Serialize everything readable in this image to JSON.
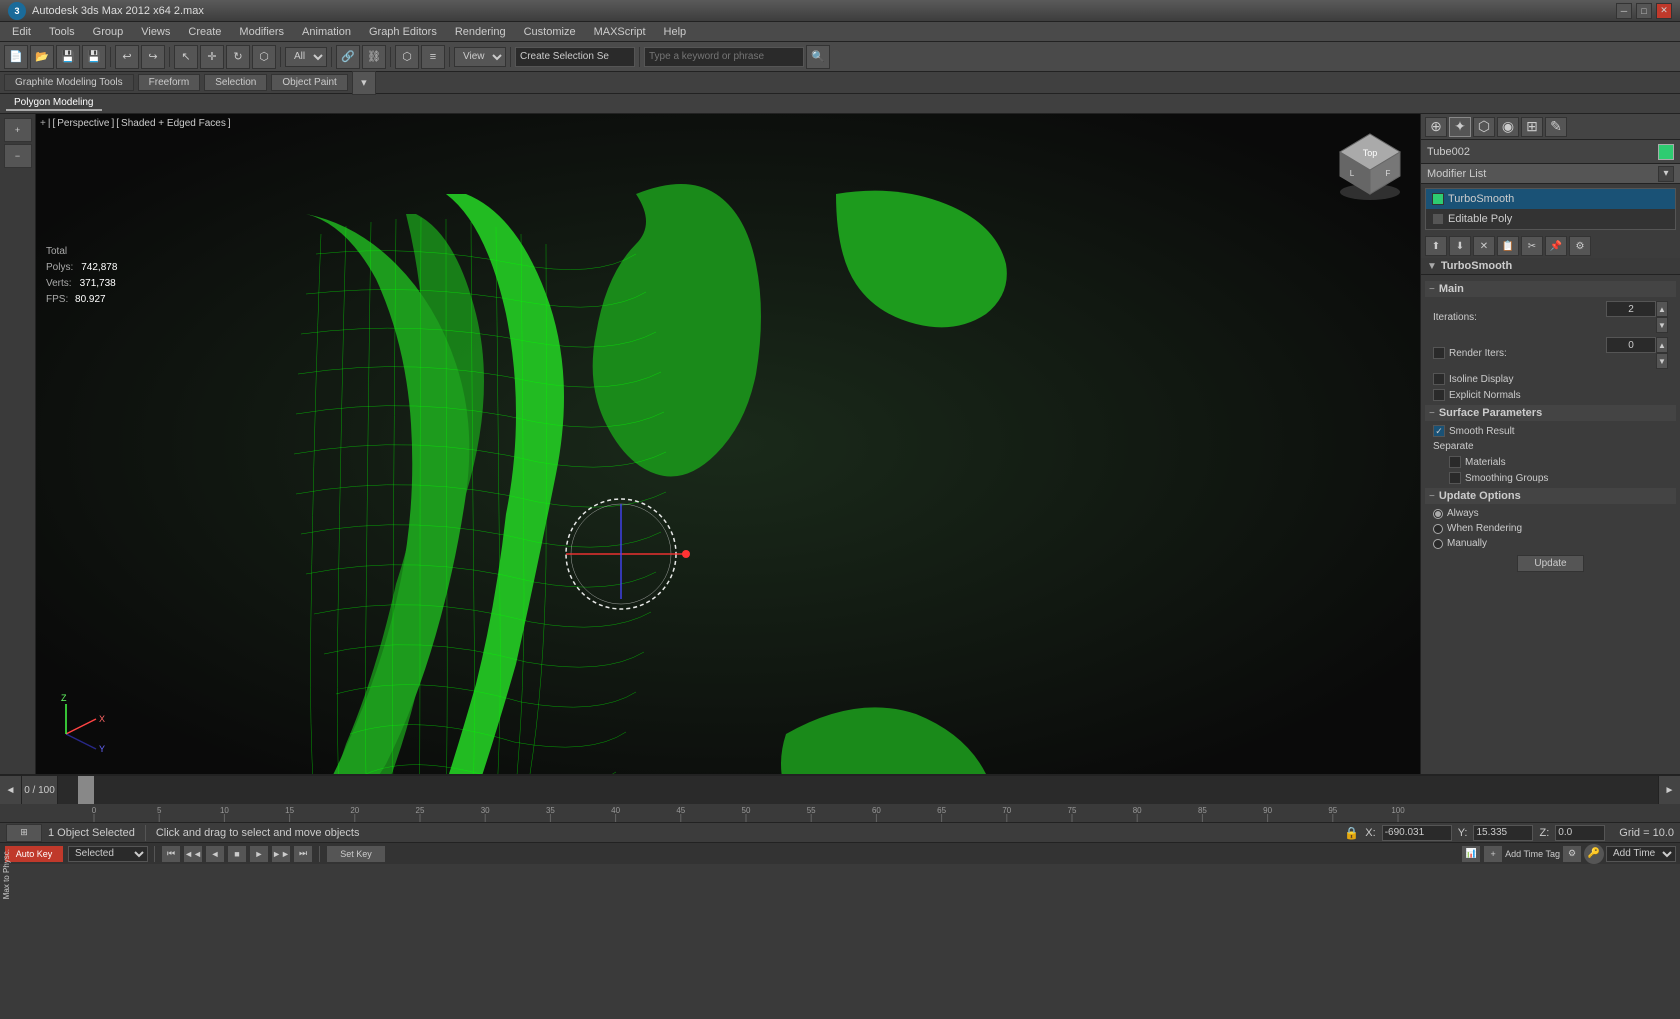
{
  "titleBar": {
    "appName": "Autodesk 3ds Max 2012 x64",
    "fileName": "2.max",
    "title": "Autodesk 3ds Max 2012 x64   2.max",
    "minimizeLabel": "─",
    "maximizeLabel": "□",
    "closeLabel": "✕"
  },
  "menuBar": {
    "items": [
      {
        "label": "Edit",
        "id": "edit"
      },
      {
        "label": "Tools",
        "id": "tools"
      },
      {
        "label": "Group",
        "id": "group"
      },
      {
        "label": "Views",
        "id": "views"
      },
      {
        "label": "Create",
        "id": "create"
      },
      {
        "label": "Modifiers",
        "id": "modifiers"
      },
      {
        "label": "Animation",
        "id": "animation"
      },
      {
        "label": "Graph Editors",
        "id": "graph-editors"
      },
      {
        "label": "Rendering",
        "id": "rendering"
      },
      {
        "label": "Customize",
        "id": "customize"
      },
      {
        "label": "MAXScript",
        "id": "maxscript"
      },
      {
        "label": "Help",
        "id": "help"
      }
    ]
  },
  "toolbar": {
    "viewDropdown": "View",
    "createSelectionLabel": "Create Selection Se",
    "searchPlaceholder": "Type a keyword or phrase"
  },
  "graphiteToolbar": {
    "tabs": [
      {
        "label": "Graphite Modeling Tools",
        "id": "graphite",
        "active": true
      },
      {
        "label": "Freeform",
        "id": "freeform"
      },
      {
        "label": "Selection",
        "id": "selection"
      },
      {
        "label": "Object Paint",
        "id": "object-paint"
      }
    ],
    "subLabel": "Polygon Modeling"
  },
  "viewport": {
    "label": "+ | [ Perspective ] [ Shaded + Edged Faces ]",
    "stats": {
      "total": "Total",
      "polysLabel": "Polys:",
      "polysValue": "742,878",
      "vertsLabel": "Verts:",
      "vertsValue": "371,738",
      "fpsLabel": "FPS:",
      "fpsValue": "80.927"
    }
  },
  "rightPanel": {
    "objectName": "Tube002",
    "objectColor": "#2ecc71",
    "modifierListLabel": "Modifier List",
    "panelIcons": [
      {
        "label": "⊕",
        "id": "create-icon",
        "active": false
      },
      {
        "label": "✦",
        "id": "modify-icon",
        "active": true
      },
      {
        "label": "⬡",
        "id": "hierarchy-icon",
        "active": false
      },
      {
        "label": "◉",
        "id": "motion-icon",
        "active": false
      },
      {
        "label": "⊞",
        "id": "display-icon",
        "active": false
      },
      {
        "label": "✎",
        "id": "utility-icon",
        "active": false
      }
    ],
    "modifierStack": {
      "items": [
        {
          "name": "TurboSmooth",
          "selected": true,
          "eyeOn": true
        },
        {
          "name": "Editable Poly",
          "selected": false,
          "eyeOn": false
        }
      ]
    },
    "stackControls": [
      "⬆",
      "⬇",
      "✕",
      "📋",
      "✂"
    ],
    "modifierTitle": "TurboSmooth",
    "properties": {
      "mainLabel": "Main",
      "iterations": {
        "label": "Iterations:",
        "value": "2"
      },
      "renderIters": {
        "label": "Render Iters:",
        "value": "0",
        "checked": false
      },
      "isolineDisplay": {
        "label": "Isoline Display",
        "checked": false
      },
      "explicitNormals": {
        "label": "Explicit Normals",
        "checked": false
      },
      "surfaceParams": {
        "label": "Surface Parameters"
      },
      "smoothResult": {
        "label": "Smooth Result",
        "checked": true
      },
      "separate": {
        "label": "Separate"
      },
      "materials": {
        "label": "Materials",
        "checked": false
      },
      "smoothingGroups": {
        "label": "Smoothing Groups",
        "checked": false
      },
      "updateOptions": {
        "label": "Update Options"
      },
      "always": {
        "label": "Always",
        "checked": true
      },
      "whenRendering": {
        "label": "When Rendering",
        "checked": false
      },
      "manually": {
        "label": "Manually",
        "checked": false
      },
      "updateButton": "Update"
    }
  },
  "bottomSection": {
    "timeDisplay": "0 / 100",
    "timeLeft": "◄",
    "timeRight": "►",
    "rulerMarks": [
      0,
      5,
      10,
      15,
      20,
      25,
      30,
      35,
      40,
      45,
      50,
      55,
      60,
      65,
      70,
      75,
      80,
      85,
      90,
      95,
      100
    ],
    "statusText": "1 Object Selected",
    "statusHint": "Click and drag to select and move objects",
    "coords": {
      "xLabel": "X:",
      "xValue": "-690.031",
      "yLabel": "Y:",
      "yValue": "15.335",
      "zLabel": "Z:",
      "zValue": "0.0",
      "gridLabel": "Grid = 10.0"
    },
    "autoKey": {
      "label": "Auto Key",
      "selectedValue": "Selected"
    },
    "setKey": {
      "label": "Set Key"
    },
    "playbackControls": [
      "⏮",
      "◄◄",
      "◄",
      "■",
      "►",
      "►►",
      "⏭"
    ]
  },
  "leftPanel": {
    "maxToPhysc": "Max to Physc."
  }
}
